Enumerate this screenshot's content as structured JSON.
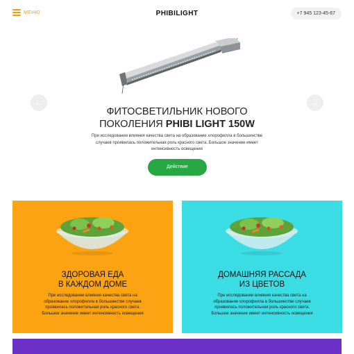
{
  "header": {
    "menu_label": "МЕНЮ",
    "logo": "PHIBILIGHT",
    "phone": "+7 945 123-45-67"
  },
  "hero": {
    "title_line1": "ФИТОСВЕТИЛЬНИК НОВОГО",
    "title_line2_prefix": "ПОКОЛЕНИЯ ",
    "title_line2_bold": "PHIBI LIGHT 150W",
    "text": "При исследовании влияния качества света на образование хлорофилла в большинстве случаев проявилась положительная роль красного света. Большое значение имеет интенсивность освещения",
    "button": "Действие"
  },
  "cards": [
    {
      "title_line1": "ЗДОРОВАЯ ЕДА",
      "title_line2": "В КАЖДОМ ДОМЕ",
      "text": "При исследовании влияния качества света на образование хлорофилла в большинстве случаев проявилась положительная роль красного света. Большое значение имеет интенсивность освещения",
      "color": "#fca311"
    },
    {
      "title_line1": "ДОМАШНЯЯ РАССАДА",
      "title_line2": "ИЗ ЦВЕТОВ",
      "text": "При исследовании влияния качества света на образование хлорофилла в большинстве случаев проявилась положительная роль красного света. Большое значение имеет интенсивность освещения",
      "color": "#3bdde5"
    }
  ],
  "colors": {
    "accent": "#f59e0b",
    "button": "#27a844",
    "purple": "#6a2fc4"
  },
  "icons": {
    "menu": "hamburger-icon",
    "prev": "arrow-left-icon",
    "next": "arrow-right-icon"
  }
}
